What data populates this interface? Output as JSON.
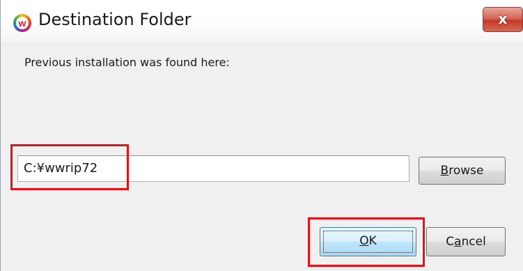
{
  "window": {
    "title": "Destination Folder",
    "app_icon_letter": "w",
    "close_glyph": "x"
  },
  "dialog": {
    "prompt": "Previous installation was found here:",
    "path_value": "C:¥wwrip72",
    "browse_label_accel": "B",
    "browse_label_rest": "rowse",
    "ok_label_accel": "O",
    "ok_label_rest": "K",
    "cancel_label_pre": "C",
    "cancel_label_accel": "a",
    "cancel_label_rest": "ncel"
  },
  "annotations": {
    "highlight_color": "#e4101a"
  },
  "icons": {
    "app": "w-logo-icon",
    "close": "close-icon"
  }
}
